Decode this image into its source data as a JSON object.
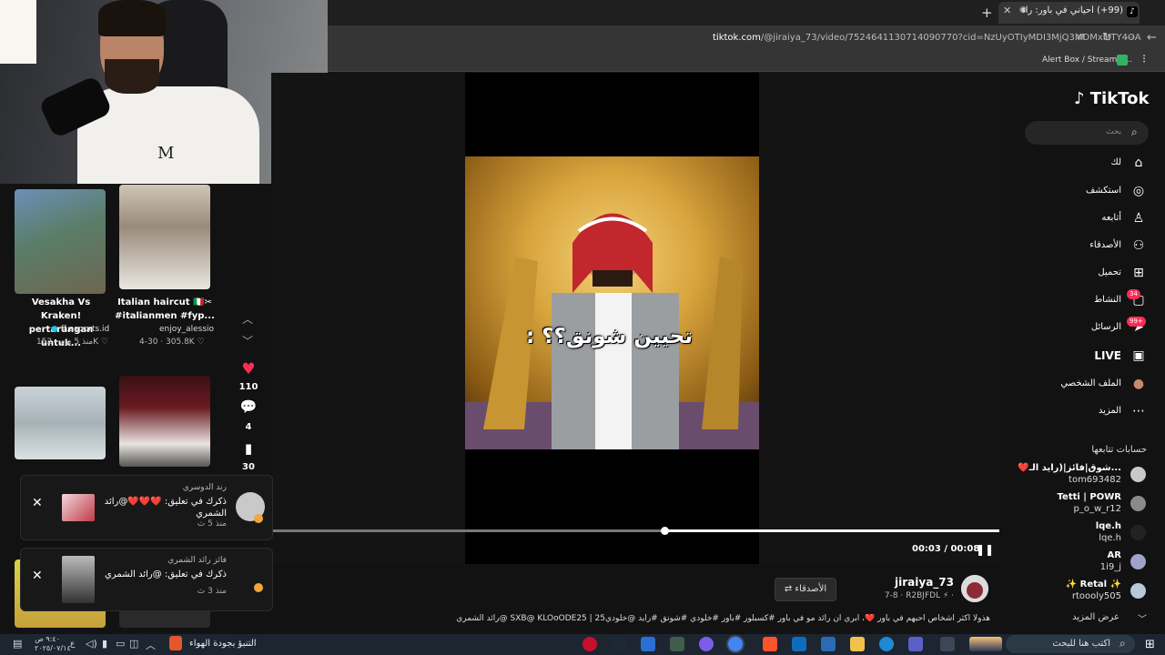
{
  "browser": {
    "tab_title": "(99+) أحياني في باور: رائد وحـ",
    "url_domain": "tiktok.com",
    "url_path": "/@jiraiya_73/video/7524641130714090770?cid=NzUyOTIyMDI3MjQ3MDMxMTY4OA",
    "bookmark": "Alert Box / Streamla..."
  },
  "recommended": [
    {
      "title": "Vesakha Vs Kraken! pertarungan untuk...",
      "author": "ff.esports.id",
      "likes": "152K",
      "age": "منذ 5 يوم"
    },
    {
      "title": "Italian haircut 🇮🇹✂ #italianmen #fyp...",
      "author": "enjoy_alessio",
      "likes": "305.8K",
      "age": "4-30"
    }
  ],
  "actions": {
    "likes": "110",
    "comments": "4",
    "saves": "30"
  },
  "video": {
    "caption": "تحيين شونق؟؟ :",
    "time": "00:03 / 00:08",
    "progress": 0.54
  },
  "post": {
    "author": "jiraiya_73",
    "sub": "7-8 · R2BJFDL ⚡ ·",
    "friends_button": "الأصدقاء",
    "description": "هذولا أكثر أشخاص احبهم في باور ❤️، أبري أن رائد مو في باور #كسبلور #باور #خلودي #شونق #رايد @خلودي25 | SXB@ KLOoODE25 @رائد الشمري"
  },
  "notifications": [
    {
      "name": "رند الدوسري",
      "text": "ذكرك في تعليق: ❤️❤️❤️@رائد الشمري",
      "time": "منذ 5 ث"
    },
    {
      "name": "فائز رائد الشمري",
      "text": "ذكرك في تعليق: @رائد الشمري",
      "time": "منذ 3 ث"
    }
  ],
  "sidebar": {
    "logo": "TikTok",
    "search_placeholder": "بحث",
    "nav": [
      {
        "label": "لك",
        "icon": "home-icon"
      },
      {
        "label": "استكشف",
        "icon": "compass-icon"
      },
      {
        "label": "أتابعه",
        "icon": "following-icon"
      },
      {
        "label": "الأصدقاء",
        "icon": "friends-icon"
      },
      {
        "label": "تحميل",
        "icon": "upload-icon"
      },
      {
        "label": "النشاط",
        "icon": "activity-icon",
        "badge": "34"
      },
      {
        "label": "الرسائل",
        "icon": "messages-icon",
        "badge": "99+"
      },
      {
        "label": "LIVE",
        "icon": "live-icon"
      },
      {
        "label": "الملف الشخصي",
        "icon": "profile-icon"
      },
      {
        "label": "المزيد",
        "icon": "more-icon"
      }
    ],
    "following_header": "حسابات تتابعها",
    "accounts": [
      {
        "name": "❤️شوق|فائز|(رايد الـ...",
        "handle": "tom693482"
      },
      {
        "name": "Tetti | POWR",
        "handle": "p_o_w_r12"
      },
      {
        "name": "lqe.h",
        "handle": "lqe.h"
      },
      {
        "name": "AR",
        "handle": "1i9_j"
      },
      {
        "name": "✨ Retal ✨",
        "handle": "rtoooly505"
      }
    ],
    "see_more": "عرض المزيد"
  },
  "taskbar": {
    "search": "اكتب هنا للبحث",
    "weather": "التنبؤ بجودة الهواء",
    "time": "٩:٤٠ ص",
    "date": "٢٠٢٥/٠٧/١٤"
  },
  "colors": {
    "accent": "#fe2c55",
    "link": "#8fb7ff",
    "page_bg": "#121212"
  }
}
